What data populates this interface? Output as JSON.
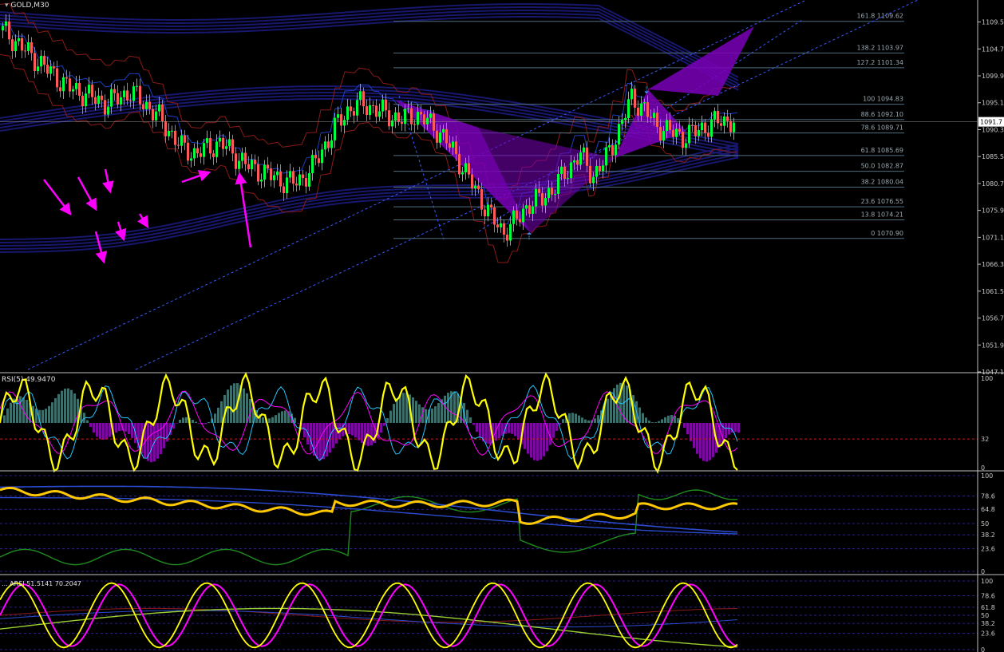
{
  "header": {
    "symbol_label": "GOLD,M30"
  },
  "colors": {
    "background": "#000000",
    "axis": "#c0c0c0",
    "bull_candle": "#00ff3c",
    "bear_candle": "#ff5a5a",
    "envelope_bands": "#1a1a7a",
    "pattern_fill": "#7a00b8",
    "fib_lines": "#4f6f7f",
    "trend_dashed": "#3b58ff",
    "arrows": "#ff00ff",
    "yellow_line": "#ffff00",
    "cyan_line": "#24c6ff",
    "magenta_line": "#ff00ff",
    "green_line": "#1e8c1e",
    "histogram_up": "#3f6f6a",
    "histogram_down": "#7d0aa0"
  },
  "main": {
    "price_scale": [
      "1109.50",
      "1104.70",
      "1099.90",
      "1095.10",
      "1090.30",
      "1085.50",
      "1080.70",
      "1075.90",
      "1071.10",
      "1066.30",
      "1061.50",
      "1056.70",
      "1051.90",
      "1047.10"
    ],
    "current_price": "1091.7",
    "fib_levels": [
      {
        "label": "161.8 1109.62"
      },
      {
        "label": "138.2 1103.97"
      },
      {
        "label": "127.2 1101.34"
      },
      {
        "label": "100 1094.83"
      },
      {
        "label": "88.6 1092.10"
      },
      {
        "label": "78.6 1089.71"
      },
      {
        "label": "61.8 1085.69"
      },
      {
        "label": "50.0 1082.87"
      },
      {
        "label": "38.2 1080.04"
      },
      {
        "label": "23.6 1076.55"
      },
      {
        "label": "13.8 1074.21"
      },
      {
        "label": "0 1070.90"
      }
    ]
  },
  "rsi_panel": {
    "label": "RSI(5) 49.9470",
    "scale": [
      "100",
      "32",
      "0"
    ]
  },
  "panel2": {
    "scale": [
      "100",
      "78.6",
      "64.8",
      "50",
      "38.2",
      "23.6",
      "0"
    ]
  },
  "panel3": {
    "label": "... ARSI 51.5141 70.2047",
    "scale": [
      "100",
      "78.6",
      "61.8",
      "50",
      "38.2",
      "23.6",
      "0"
    ]
  },
  "chart_data": {
    "type": "line",
    "title": "GOLD,M30",
    "price_ylim": [
      1047.1,
      1112.0
    ],
    "fib_values": [
      1109.62,
      1103.97,
      1101.34,
      1094.83,
      1092.1,
      1089.71,
      1085.69,
      1082.87,
      1080.04,
      1076.55,
      1074.21,
      1070.9
    ],
    "price_path": [
      1108,
      1106,
      1104,
      1102,
      1100,
      1098,
      1097,
      1096,
      1095,
      1096,
      1097,
      1095,
      1093,
      1090,
      1087,
      1086,
      1087,
      1088,
      1086,
      1084,
      1083,
      1082,
      1081,
      1081,
      1083,
      1087,
      1091,
      1094,
      1095,
      1094,
      1093,
      1092,
      1093,
      1092,
      1090,
      1087,
      1083,
      1079,
      1075,
      1072,
      1074,
      1077,
      1078,
      1080,
      1083,
      1086,
      1082,
      1085,
      1090,
      1096,
      1094,
      1091,
      1090,
      1089,
      1090,
      1091,
      1092,
      1091.7
    ],
    "rsi_value": 49.947,
    "rsi_levels": [
      100,
      32,
      0
    ],
    "panel2_levels": [
      100,
      78.6,
      64.8,
      50,
      38.2,
      23.6,
      0
    ],
    "arsi_values": [
      51.5141,
      70.2047
    ],
    "panel3_levels": [
      100,
      78.6,
      61.8,
      50,
      38.2,
      23.6,
      0
    ]
  }
}
